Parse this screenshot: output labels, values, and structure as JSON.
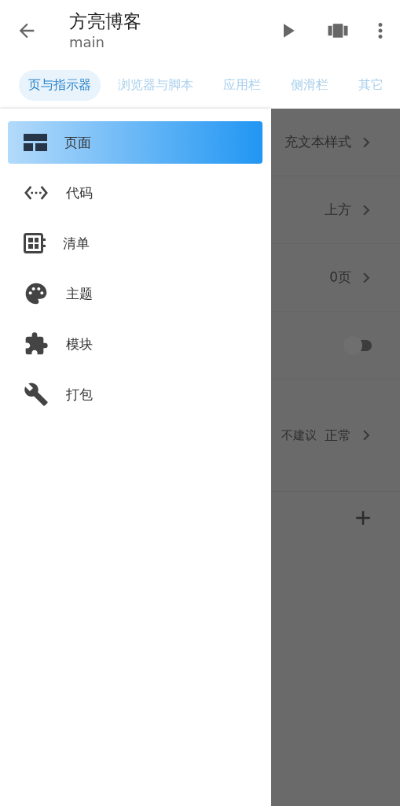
{
  "app_bar": {
    "title": "方亮博客",
    "subtitle": "main"
  },
  "tabs": [
    {
      "label": "页与指示器",
      "selected": true
    },
    {
      "label": "浏览器与脚本",
      "selected": false
    },
    {
      "label": "应用栏",
      "selected": false
    },
    {
      "label": "侧滑栏",
      "selected": false
    },
    {
      "label": "其它",
      "selected": false
    }
  ],
  "drawer": {
    "items": [
      {
        "label": "页面",
        "kind": "page",
        "selected": true
      },
      {
        "label": "代码",
        "kind": "code",
        "selected": false
      },
      {
        "label": "清单",
        "kind": "list",
        "selected": false
      },
      {
        "label": "主题",
        "kind": "palette",
        "selected": false
      },
      {
        "label": "模块",
        "kind": "puzzle",
        "selected": false
      },
      {
        "label": "打包",
        "kind": "wrench",
        "selected": false
      }
    ]
  },
  "background_rows": [
    {
      "kind": "value",
      "value": "充文本样式"
    },
    {
      "kind": "value",
      "value": "上方"
    },
    {
      "kind": "value",
      "value": "0页"
    },
    {
      "kind": "switch",
      "on": false
    },
    {
      "kind": "value",
      "note": "不建议",
      "value": "正常"
    }
  ]
}
